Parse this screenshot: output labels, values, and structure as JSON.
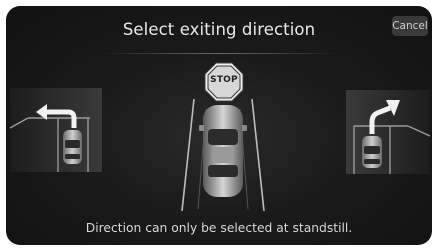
{
  "header": {
    "title": "Select exiting direction",
    "cancel_label": "Cancel"
  },
  "stop_sign": {
    "label": "STOP"
  },
  "options": {
    "left": {
      "icon": "left-turn-arrow-icon"
    },
    "right": {
      "icon": "right-turn-arrow-icon"
    }
  },
  "footer": {
    "message": "Direction can only be selected at standstill."
  },
  "colors": {
    "background": "#151515",
    "text": "#e9e9e9",
    "stop_sign": "#d7d7d7"
  }
}
